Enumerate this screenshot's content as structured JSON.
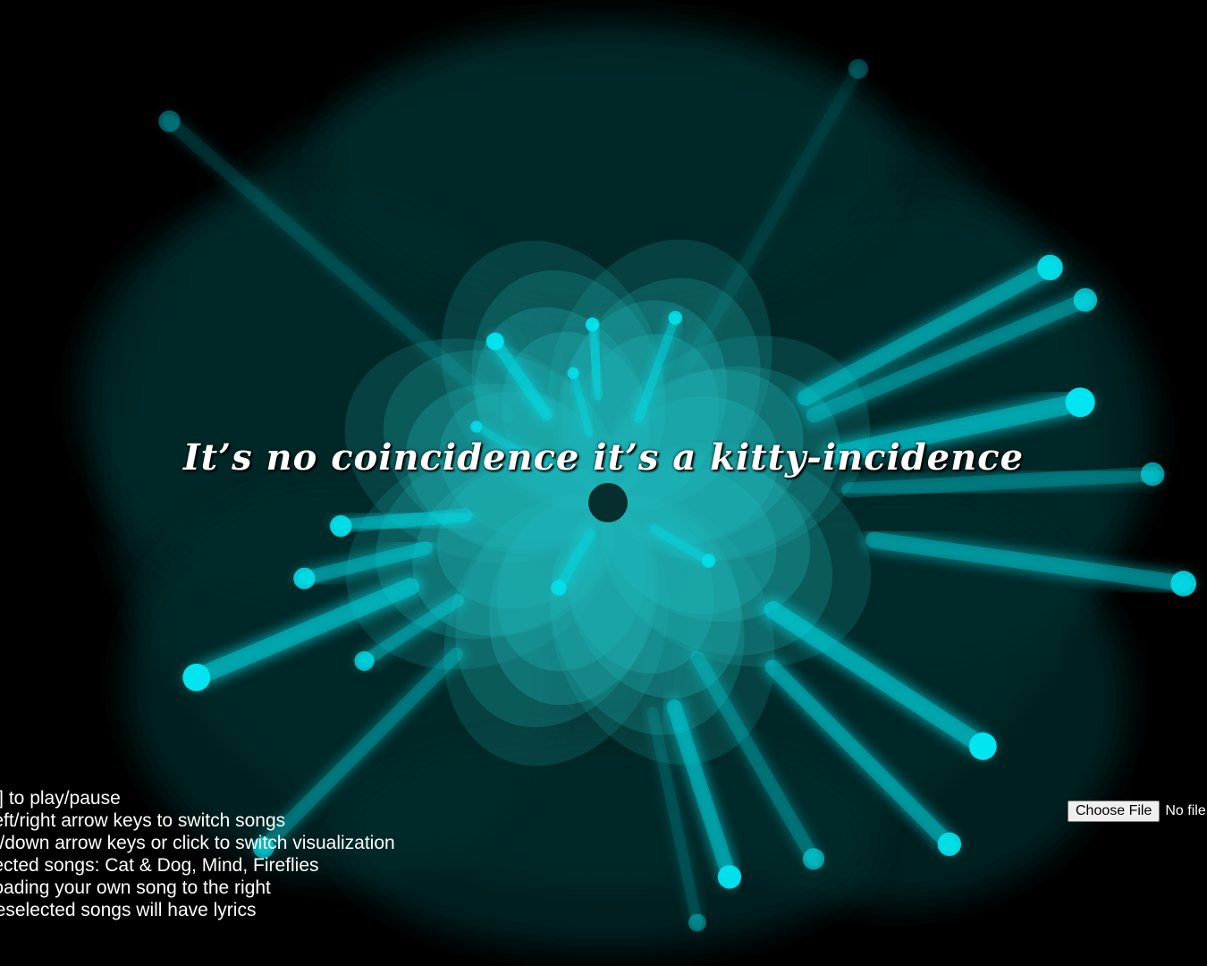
{
  "lyric": {
    "text": "It’s no coincidence it’s a kitty-incidence"
  },
  "instructions": {
    "lines": [
      "ce] to play/pause",
      "] left/right arrow keys to switch songs",
      "up/down arrow keys or click to switch visualization",
      "elected songs: Cat & Dog, Mind, Fireflies",
      "ploading your own song to the right",
      " preselected songs will have lyrics"
    ]
  },
  "file_upload": {
    "button_label": "Choose File",
    "status": "No file chosen"
  },
  "visualization": {
    "mode": "flower",
    "petal_count": 8,
    "colors": {
      "background": "#000000",
      "petal": "#1fb5b8",
      "ray": "#00e5f0",
      "halo": "#062a2a"
    }
  }
}
